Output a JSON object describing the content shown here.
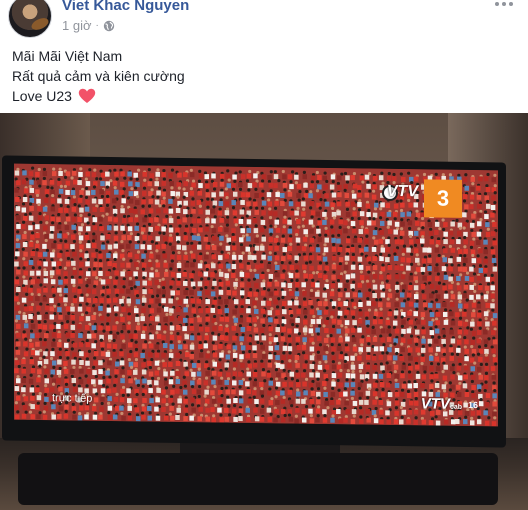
{
  "post": {
    "author": "Viet Khac Nguyen",
    "time": "1 giờ",
    "separator": "·",
    "privacy_icon": "globe-icon",
    "more_icon": "more-options-icon",
    "text_lines": [
      "Mãi Mãi Việt Nam",
      "Rất quả cảm và kiên cường",
      "Love U23"
    ],
    "emoji": "heart-icon"
  },
  "photo": {
    "overlay_live": "trực tiếp",
    "channel_number": "3",
    "overlay_vtv": "VTV",
    "overlay_vtvcab": "VTV",
    "overlay_vtvcab_suffix": "cab",
    "overlay_age": "16"
  },
  "colors": {
    "author_blue": "#365899",
    "meta_gray": "#90949c",
    "heart_red": "#f25268",
    "jersey_red": "#d8342b",
    "channel_orange": "#f08a22"
  }
}
